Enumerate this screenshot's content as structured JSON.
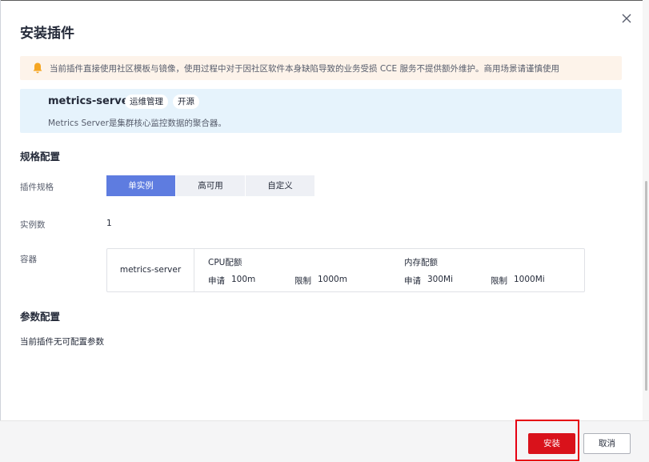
{
  "dialog": {
    "title": "安装插件"
  },
  "warning": {
    "text": "当前插件直接使用社区模板与镜像，使用过程中对于因社区软件本身缺陷导致的业务受损 CCE 服务不提供额外维护。商用场景请谨慎使用",
    "icon": "bell-icon",
    "icon_color": "#f5a623"
  },
  "plugin": {
    "name": "metrics-server",
    "tags": [
      "运维管理",
      "开源"
    ],
    "description": "Metrics Server是集群核心监控数据的聚合器。"
  },
  "spec_section": {
    "title": "规格配置",
    "plugin_spec_label": "插件规格",
    "spec_options": [
      "单实例",
      "高可用",
      "自定义"
    ],
    "selected_spec": "单实例",
    "instances_label": "实例数",
    "instances_value": "1",
    "container_label": "容器",
    "container": {
      "name": "metrics-server",
      "cpu_title": "CPU配额",
      "cpu_request_label": "申请",
      "cpu_request": "100m",
      "cpu_limit_label": "限制",
      "cpu_limit": "1000m",
      "mem_title": "内存配额",
      "mem_request_label": "申请",
      "mem_request": "300Mi",
      "mem_limit_label": "限制",
      "mem_limit": "1000Mi"
    }
  },
  "param_section": {
    "title": "参数配置",
    "text": "当前插件无可配置参数"
  },
  "footer": {
    "install_label": "安装",
    "cancel_label": "取消"
  },
  "colors": {
    "primary_blue": "#5e7ce0",
    "install_red": "#d9121b",
    "highlight_red": "#e60012"
  }
}
